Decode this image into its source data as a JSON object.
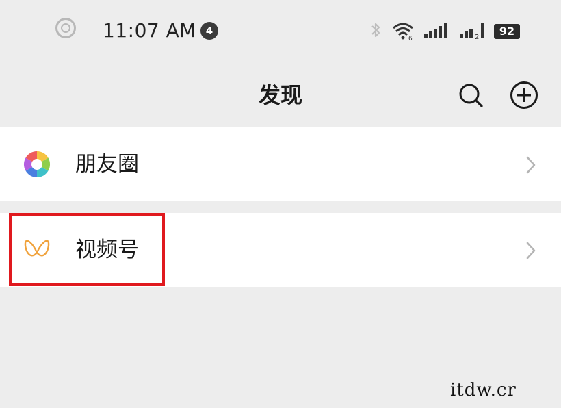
{
  "status_bar": {
    "time": "11:07 AM",
    "notification_count": "4",
    "wifi_sub": "6",
    "signal2_sub": "2",
    "battery": "92"
  },
  "header": {
    "title": "发现",
    "search_icon": "search-icon",
    "add_icon": "add-circle-icon"
  },
  "list": {
    "items": [
      {
        "label": "朋友圈",
        "icon": "moments-icon"
      },
      {
        "label": "视频号",
        "icon": "channels-icon"
      }
    ]
  },
  "annotation": {
    "highlight_color": "#e0191e"
  },
  "watermark": "itdw.cr"
}
